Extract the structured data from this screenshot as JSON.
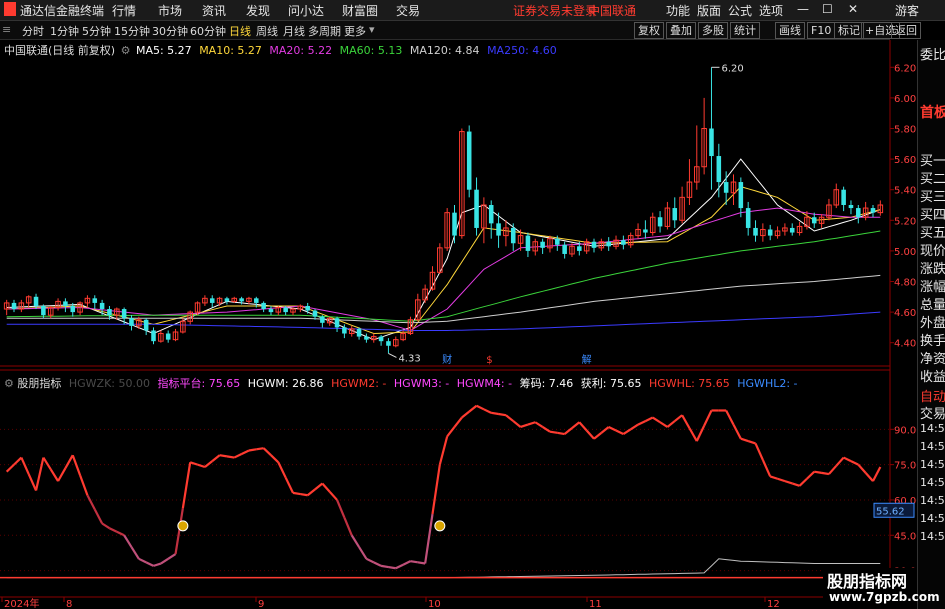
{
  "app": {
    "title": "通达信金融终端",
    "menu": [
      "行情",
      "市场",
      "资讯",
      "发现",
      "问小达",
      "财富圈",
      "交易"
    ],
    "notice": "证券交易未登录",
    "stock": "中国联通",
    "right_menu": [
      "功能",
      "版面",
      "公式",
      "选项"
    ],
    "guest": "游客"
  },
  "timeframes": {
    "items": [
      "分时",
      "1分钟",
      "5分钟",
      "15分钟",
      "30分钟",
      "60分钟",
      "日线",
      "周线",
      "月线",
      "多周期",
      "更多"
    ],
    "active": "日线"
  },
  "toolbar": {
    "buttons": [
      "复权",
      "叠加",
      "多股",
      "统计",
      "画线",
      "F10",
      "标记",
      "+自选",
      "返回"
    ],
    "gear": "⚙"
  },
  "right_panel": {
    "items": [
      "委比",
      "首板",
      "买一",
      "买二",
      "买三",
      "买四",
      "买五",
      "现价",
      "涨跌",
      "涨幅",
      "总量",
      "外盘",
      "换手",
      "净资",
      "收益",
      "自动",
      "交易"
    ],
    "extra_values": [
      "14:56",
      "14:56",
      "14:56",
      "14:56",
      "14:56",
      "14:56",
      "14:56"
    ]
  },
  "main_chart": {
    "name": "中国联通(日线 前复权)",
    "ma": [
      {
        "label": "MA5: 5.27",
        "color": "#ffffff"
      },
      {
        "label": "MA10: 5.27",
        "color": "#ffd83b"
      },
      {
        "label": "MA20: 5.22",
        "color": "#e23be2"
      },
      {
        "label": "MA60: 5.13",
        "color": "#3bd43b"
      },
      {
        "label": "MA120: 4.84",
        "color": "#cfcfcf"
      },
      {
        "label": "MA250: 4.60",
        "color": "#3b3bff"
      }
    ],
    "high_label": "6.20",
    "low_label": "4.33",
    "event_marks": [
      "财",
      "$",
      "解"
    ]
  },
  "indicator": {
    "name": "股朋指标",
    "legend": [
      {
        "label": "HGWZK: 50.00",
        "color": "#4a4a4a"
      },
      {
        "label": "指标平台: 75.65",
        "color": "#ff49ff"
      },
      {
        "label": "HGWM: 26.86",
        "color": "#ffffff"
      },
      {
        "label": "HGWM2: -",
        "color": "#ff3b30"
      },
      {
        "label": "HGWM3: -",
        "color": "#ff49ff"
      },
      {
        "label": "HGWM4: -",
        "color": "#ff49ff"
      },
      {
        "label": "筹码: 7.46",
        "color": "#ffffff"
      },
      {
        "label": "获利: 75.65",
        "color": "#ffffff"
      },
      {
        "label": "HGWHL: 75.65",
        "color": "#ff3b30"
      },
      {
        "label": "HGWHL2: -",
        "color": "#3b8bff"
      }
    ],
    "current_value": "55.62"
  },
  "date_axis": {
    "labels": [
      "2024年",
      "8",
      "9",
      "10",
      "11",
      "12"
    ]
  },
  "watermark": {
    "line1": "股朋指标网",
    "line2": "www.7gpzb.com"
  },
  "chart_data": [
    {
      "type": "candlestick",
      "title": "中国联通(日线 前复权)",
      "x_axis": [
        "2024年",
        "8",
        "9",
        "10",
        "11",
        "12"
      ],
      "ylim": [
        4.3,
        6.3
      ],
      "y_ticks": [
        4.4,
        4.6,
        4.8,
        5.0,
        5.2,
        5.4,
        5.6,
        5.8,
        6.0,
        6.2
      ],
      "colors": {
        "up": "#ff3b30",
        "down": "#39e5e5"
      },
      "candles": [
        [
          4.62,
          4.66,
          4.58,
          4.68
        ],
        [
          4.66,
          4.62,
          4.6,
          4.68
        ],
        [
          4.62,
          4.66,
          4.6,
          4.68
        ],
        [
          4.66,
          4.7,
          4.63,
          4.71
        ],
        [
          4.7,
          4.64,
          4.62,
          4.72
        ],
        [
          4.64,
          4.58,
          4.56,
          4.65
        ],
        [
          4.58,
          4.63,
          4.56,
          4.64
        ],
        [
          4.63,
          4.67,
          4.61,
          4.69
        ],
        [
          4.67,
          4.64,
          4.6,
          4.69
        ],
        [
          4.64,
          4.6,
          4.57,
          4.66
        ],
        [
          4.6,
          4.66,
          4.58,
          4.67
        ],
        [
          4.66,
          4.69,
          4.63,
          4.71
        ],
        [
          4.69,
          4.66,
          4.62,
          4.71
        ],
        [
          4.66,
          4.62,
          4.58,
          4.68
        ],
        [
          4.62,
          4.58,
          4.55,
          4.64
        ],
        [
          4.58,
          4.62,
          4.55,
          4.63
        ],
        [
          4.62,
          4.56,
          4.52,
          4.63
        ],
        [
          4.56,
          4.51,
          4.48,
          4.58
        ],
        [
          4.51,
          4.55,
          4.49,
          4.57
        ],
        [
          4.55,
          4.48,
          4.45,
          4.56
        ],
        [
          4.48,
          4.41,
          4.39,
          4.5
        ],
        [
          4.41,
          4.46,
          4.4,
          4.48
        ],
        [
          4.46,
          4.42,
          4.4,
          4.48
        ],
        [
          4.42,
          4.47,
          4.41,
          4.49
        ],
        [
          4.47,
          4.54,
          4.46,
          4.56
        ],
        [
          4.54,
          4.6,
          4.52,
          4.61
        ],
        [
          4.6,
          4.66,
          4.58,
          4.67
        ],
        [
          4.66,
          4.69,
          4.64,
          4.71
        ],
        [
          4.69,
          4.66,
          4.63,
          4.71
        ],
        [
          4.66,
          4.69,
          4.64,
          4.7
        ],
        [
          4.69,
          4.67,
          4.65,
          4.7
        ],
        [
          4.67,
          4.69,
          4.66,
          4.7
        ],
        [
          4.69,
          4.67,
          4.65,
          4.7
        ],
        [
          4.67,
          4.69,
          4.65,
          4.7
        ],
        [
          4.69,
          4.66,
          4.63,
          4.7
        ],
        [
          4.66,
          4.62,
          4.6,
          4.67
        ],
        [
          4.62,
          4.6,
          4.58,
          4.64
        ],
        [
          4.6,
          4.63,
          4.58,
          4.64
        ],
        [
          4.63,
          4.6,
          4.58,
          4.64
        ],
        [
          4.6,
          4.62,
          4.58,
          4.63
        ],
        [
          4.62,
          4.64,
          4.6,
          4.65
        ],
        [
          4.64,
          4.61,
          4.59,
          4.66
        ],
        [
          4.61,
          4.57,
          4.55,
          4.62
        ],
        [
          4.57,
          4.53,
          4.5,
          4.58
        ],
        [
          4.53,
          4.56,
          4.51,
          4.57
        ],
        [
          4.56,
          4.5,
          4.47,
          4.57
        ],
        [
          4.5,
          4.46,
          4.43,
          4.52
        ],
        [
          4.46,
          4.49,
          4.44,
          4.51
        ],
        [
          4.49,
          4.44,
          4.42,
          4.5
        ],
        [
          4.44,
          4.42,
          4.4,
          4.46
        ],
        [
          4.42,
          4.44,
          4.4,
          4.46
        ],
        [
          4.44,
          4.41,
          4.38,
          4.45
        ],
        [
          4.41,
          4.38,
          4.33,
          4.43
        ],
        [
          4.38,
          4.42,
          4.37,
          4.44
        ],
        [
          4.42,
          4.46,
          4.41,
          4.48
        ],
        [
          4.46,
          4.55,
          4.45,
          4.57
        ],
        [
          4.55,
          4.68,
          4.54,
          4.72
        ],
        [
          4.68,
          4.75,
          4.66,
          4.78
        ],
        [
          4.75,
          4.86,
          4.74,
          4.9
        ],
        [
          4.86,
          5.02,
          4.85,
          5.05
        ],
        [
          5.02,
          5.25,
          5.0,
          5.28
        ],
        [
          5.25,
          5.1,
          5.05,
          5.3
        ],
        [
          5.1,
          5.78,
          5.08,
          5.8
        ],
        [
          5.78,
          5.4,
          5.35,
          5.82
        ],
        [
          5.4,
          5.15,
          5.1,
          5.48
        ],
        [
          5.15,
          5.3,
          5.05,
          5.35
        ],
        [
          5.3,
          5.18,
          5.08,
          5.33
        ],
        [
          5.18,
          5.1,
          5.02,
          5.25
        ],
        [
          5.1,
          5.15,
          5.03,
          5.2
        ],
        [
          5.15,
          5.05,
          5.0,
          5.18
        ],
        [
          5.05,
          5.1,
          5.0,
          5.14
        ],
        [
          5.1,
          5.0,
          4.96,
          5.12
        ],
        [
          5.0,
          5.06,
          4.97,
          5.08
        ],
        [
          5.06,
          5.02,
          4.98,
          5.08
        ],
        [
          5.02,
          5.08,
          4.99,
          5.1
        ],
        [
          5.08,
          5.04,
          5.0,
          5.1
        ],
        [
          5.04,
          4.98,
          4.95,
          5.06
        ],
        [
          4.98,
          5.03,
          4.96,
          5.05
        ],
        [
          5.03,
          5.0,
          4.97,
          5.06
        ],
        [
          5.0,
          5.06,
          4.98,
          5.08
        ],
        [
          5.06,
          5.02,
          4.99,
          5.08
        ],
        [
          5.02,
          5.06,
          5.0,
          5.08
        ],
        [
          5.06,
          5.03,
          5.0,
          5.09
        ],
        [
          5.03,
          5.07,
          5.01,
          5.1
        ],
        [
          5.07,
          5.04,
          5.01,
          5.1
        ],
        [
          5.04,
          5.1,
          5.02,
          5.12
        ],
        [
          5.1,
          5.14,
          5.08,
          5.18
        ],
        [
          5.14,
          5.12,
          5.08,
          5.2
        ],
        [
          5.12,
          5.22,
          5.1,
          5.25
        ],
        [
          5.22,
          5.16,
          5.12,
          5.26
        ],
        [
          5.16,
          5.28,
          5.14,
          5.32
        ],
        [
          5.28,
          5.2,
          5.15,
          5.35
        ],
        [
          5.2,
          5.35,
          5.18,
          5.42
        ],
        [
          5.35,
          5.45,
          5.3,
          5.6
        ],
        [
          5.45,
          5.55,
          5.4,
          5.82
        ],
        [
          5.55,
          5.8,
          5.5,
          6.0
        ],
        [
          5.8,
          5.62,
          5.4,
          6.2
        ],
        [
          5.62,
          5.45,
          5.35,
          5.7
        ],
        [
          5.45,
          5.38,
          5.3,
          5.52
        ],
        [
          5.38,
          5.45,
          5.3,
          5.5
        ],
        [
          5.45,
          5.28,
          5.22,
          5.48
        ],
        [
          5.28,
          5.15,
          5.1,
          5.32
        ],
        [
          5.15,
          5.1,
          5.06,
          5.2
        ],
        [
          5.1,
          5.14,
          5.06,
          5.18
        ],
        [
          5.14,
          5.1,
          5.07,
          5.17
        ],
        [
          5.1,
          5.13,
          5.08,
          5.16
        ],
        [
          5.13,
          5.15,
          5.1,
          5.18
        ],
        [
          5.15,
          5.12,
          5.1,
          5.18
        ],
        [
          5.12,
          5.16,
          5.1,
          5.19
        ],
        [
          5.16,
          5.22,
          5.14,
          5.26
        ],
        [
          5.22,
          5.18,
          5.15,
          5.25
        ],
        [
          5.18,
          5.22,
          5.15,
          5.24
        ],
        [
          5.22,
          5.3,
          5.2,
          5.34
        ],
        [
          5.3,
          5.4,
          5.28,
          5.44
        ],
        [
          5.4,
          5.3,
          5.26,
          5.42
        ],
        [
          5.3,
          5.28,
          5.24,
          5.33
        ],
        [
          5.28,
          5.22,
          5.18,
          5.3
        ],
        [
          5.22,
          5.28,
          5.2,
          5.32
        ],
        [
          5.28,
          5.25,
          5.22,
          5.3
        ],
        [
          5.25,
          5.3,
          5.23,
          5.33
        ]
      ],
      "series": [
        {
          "name": "MA5",
          "color": "#ffffff",
          "x": [
            0,
            10,
            20,
            30,
            40,
            50,
            55,
            60,
            62,
            65,
            70,
            80,
            90,
            96,
            100,
            105,
            110,
            115,
            119
          ],
          "values": [
            4.63,
            4.65,
            4.46,
            4.67,
            4.62,
            4.42,
            4.5,
            4.95,
            5.25,
            5.3,
            5.12,
            5.03,
            5.08,
            5.35,
            5.6,
            5.3,
            5.13,
            5.2,
            5.27
          ]
        },
        {
          "name": "MA10",
          "color": "#ffd83b",
          "x": [
            0,
            10,
            20,
            30,
            40,
            50,
            55,
            60,
            65,
            70,
            80,
            90,
            96,
            100,
            105,
            110,
            115,
            119
          ],
          "values": [
            4.62,
            4.64,
            4.52,
            4.64,
            4.64,
            4.46,
            4.47,
            4.78,
            5.15,
            5.12,
            5.05,
            5.06,
            5.22,
            5.42,
            5.35,
            5.2,
            5.22,
            5.27
          ]
        },
        {
          "name": "MA20",
          "color": "#e23be2",
          "x": [
            0,
            10,
            20,
            30,
            40,
            50,
            55,
            60,
            65,
            70,
            80,
            90,
            100,
            105,
            110,
            115,
            119
          ],
          "values": [
            4.62,
            4.63,
            4.58,
            4.6,
            4.64,
            4.55,
            4.48,
            4.62,
            4.88,
            5.02,
            5.05,
            5.1,
            5.25,
            5.28,
            5.24,
            5.22,
            5.22
          ]
        },
        {
          "name": "MA60",
          "color": "#3bd43b",
          "x": [
            0,
            20,
            40,
            55,
            60,
            70,
            80,
            90,
            100,
            110,
            119
          ],
          "values": [
            4.57,
            4.58,
            4.58,
            4.54,
            4.57,
            4.7,
            4.82,
            4.92,
            5.0,
            5.06,
            5.13
          ]
        },
        {
          "name": "MA120",
          "color": "#cfcfcf",
          "x": [
            0,
            20,
            40,
            55,
            60,
            70,
            80,
            90,
            100,
            110,
            119
          ],
          "values": [
            4.56,
            4.56,
            4.56,
            4.53,
            4.54,
            4.6,
            4.67,
            4.72,
            4.77,
            4.8,
            4.84
          ]
        },
        {
          "name": "MA250",
          "color": "#3b3bff",
          "x": [
            0,
            20,
            40,
            55,
            60,
            70,
            80,
            90,
            100,
            110,
            119
          ],
          "values": [
            4.52,
            4.52,
            4.5,
            4.48,
            4.48,
            4.49,
            4.51,
            4.53,
            4.55,
            4.57,
            4.6
          ]
        }
      ]
    },
    {
      "type": "line",
      "title": "股朋指标",
      "ylim": [
        26,
        105
      ],
      "y_ticks": [
        30,
        45,
        60,
        75,
        90
      ],
      "series": [
        {
          "name": "HGWHL",
          "color": "#ff3b30",
          "x": [
            0,
            2,
            4,
            5,
            7,
            9,
            11,
            13,
            14,
            16,
            18,
            20,
            21,
            23,
            25,
            27,
            29,
            31,
            33,
            35,
            37,
            39,
            41,
            43,
            45,
            47,
            49,
            51,
            53,
            55,
            57,
            59,
            60,
            62,
            64,
            66,
            68,
            70,
            72,
            74,
            76,
            78,
            80,
            82,
            84,
            86,
            88,
            90,
            92,
            94,
            96,
            98,
            100,
            102,
            104,
            106,
            108,
            110,
            112,
            114,
            116,
            118,
            119
          ],
          "values": [
            72,
            78,
            64,
            78,
            68,
            79,
            62,
            50,
            48,
            45,
            35,
            32,
            33,
            37,
            76,
            74,
            79,
            78,
            81,
            82,
            76,
            63,
            62,
            67,
            60,
            45,
            35,
            32,
            31,
            34,
            33,
            75,
            87,
            95,
            100,
            97,
            96,
            91,
            93,
            89,
            88,
            93,
            86,
            91,
            88,
            92,
            95,
            91,
            96,
            85,
            98,
            98,
            86,
            84,
            70,
            68,
            66,
            72,
            71,
            78,
            75,
            68,
            74
          ]
        },
        {
          "name": "HGWM",
          "color": "#ffffff",
          "x": [
            0,
            20,
            40,
            60,
            80,
            95,
            97,
            100,
            110,
            119
          ],
          "values": [
            27,
            27,
            27,
            27,
            28,
            29,
            35,
            34,
            33,
            33
          ]
        }
      ]
    }
  ]
}
